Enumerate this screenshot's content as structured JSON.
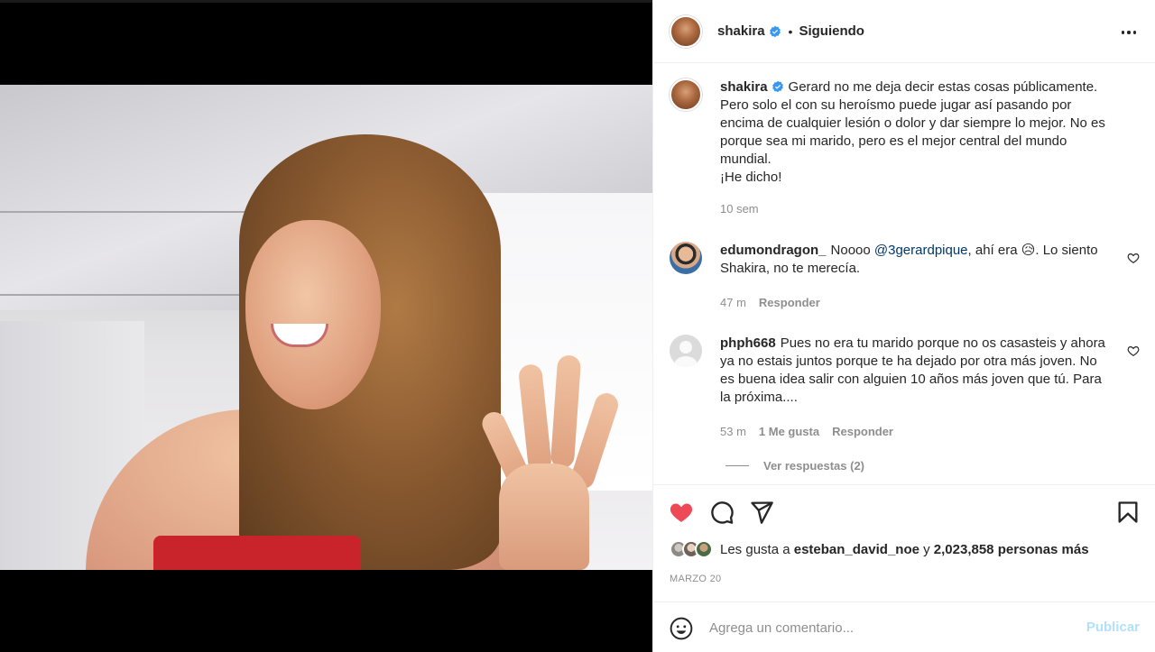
{
  "post": {
    "author": "shakira",
    "follow_status": "Siguiendo",
    "caption_lines": [
      "Gerard no me deja decir estas cosas públicamente.",
      "Pero solo el con su heroísmo puede jugar así pasando por",
      "encima de cualquier lesión o dolor y dar siempre lo mejor. No es",
      "porque sea mi marido, pero es el mejor central del mundo",
      "mundial.",
      "¡He dicho!"
    ],
    "caption_age": "10 sem"
  },
  "comments": [
    {
      "username": "edumondragon_",
      "text_before": "Noooo ",
      "mention": "@3gerardpique",
      "text_after_line1": ", ahí era 😥. Lo siento",
      "text_line2": "Shakira, no te merecía.",
      "age": "47 m",
      "reply_label": "Responder"
    },
    {
      "username": "phph668",
      "lines": [
        "Pues no era tu marido porque no os casasteis y ahora",
        "ya no estais juntos porque te ha dejado por otra más joven. No",
        "es buena idea salir con alguien 10 años más joven que tú. Para",
        "la próxima...."
      ],
      "age": "53 m",
      "likes_label": "1 Me gusta",
      "reply_label": "Responder",
      "view_replies": "Ver respuestas (2)"
    }
  ],
  "likes": {
    "prefix": "Les gusta a ",
    "user": "esteban_david_noe",
    "connector": " y ",
    "count": "2,023,858 personas más"
  },
  "date": "MARZO 20",
  "composer": {
    "placeholder": "Agrega un comentario...",
    "publish_label": "Publicar"
  },
  "colors": {
    "heart_liked": "#ed4956",
    "verified_badge": "#3897f0",
    "publish_disabled": "#b2dffc",
    "mention": "#00376b"
  },
  "icons": [
    "more-options-icon",
    "verified-badge-icon",
    "heart-icon",
    "comment-icon",
    "share-icon",
    "bookmark-icon",
    "emoji-icon"
  ]
}
